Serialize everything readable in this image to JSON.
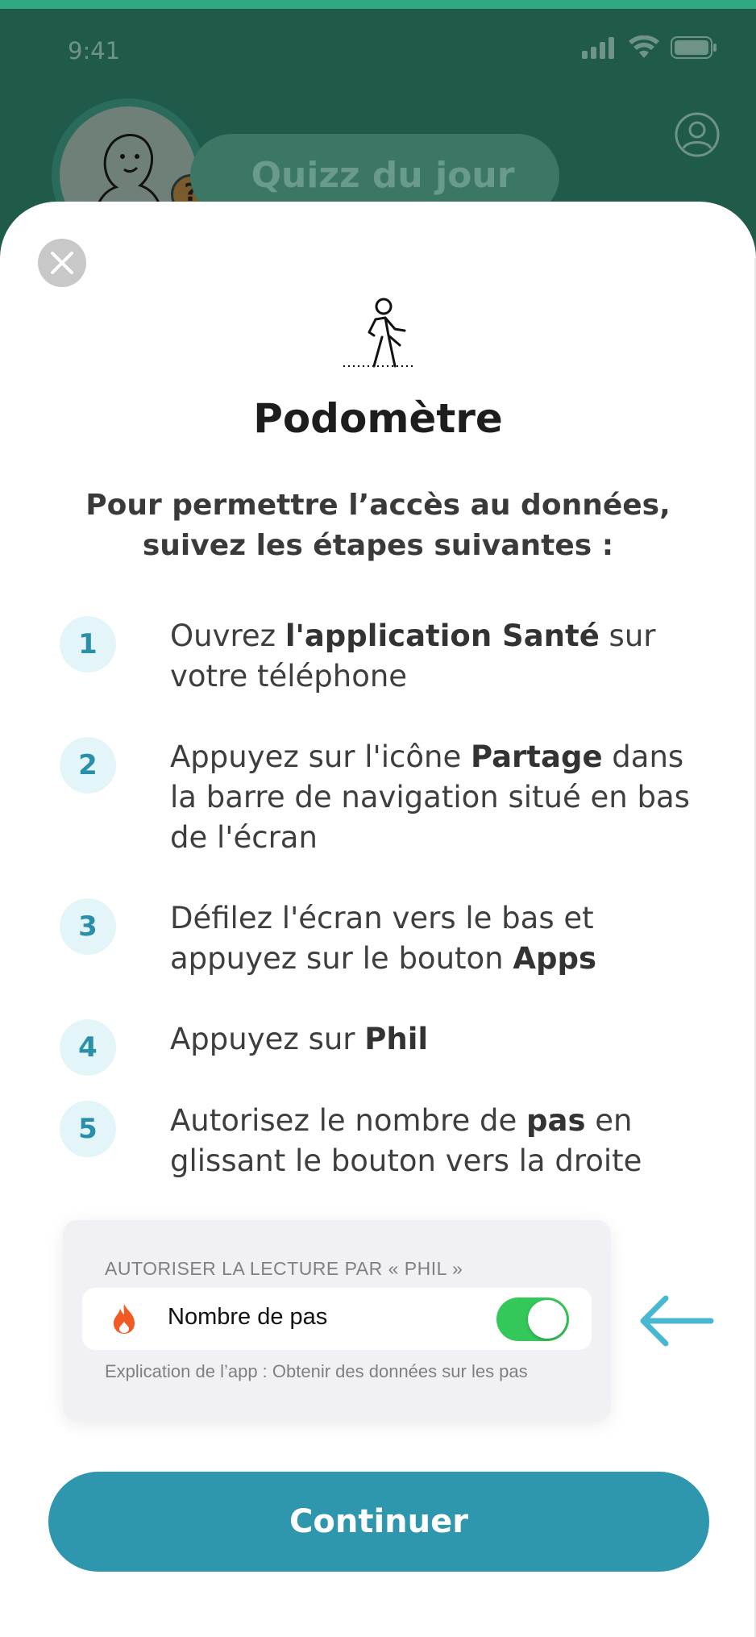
{
  "status_bar": {
    "time": "9:41"
  },
  "background": {
    "quiz_label": "Quizz du jour",
    "badge": "?"
  },
  "modal": {
    "title": "Podomètre",
    "subtitle": "Pour permettre l’accès au données, suivez les étapes suivantes :",
    "steps": [
      {
        "num": "1",
        "parts": [
          {
            "t": "Ouvrez "
          },
          {
            "t": "l'application Santé",
            "b": true
          },
          {
            "t": " sur votre téléphone"
          }
        ]
      },
      {
        "num": "2",
        "parts": [
          {
            "t": "Appuyez sur l'icône "
          },
          {
            "t": "Partage",
            "b": true
          },
          {
            "t": " dans la barre de navigation situé en bas de l'écran"
          }
        ]
      },
      {
        "num": "3",
        "parts": [
          {
            "t": "Défilez l'écran vers le bas et appuyez sur le bouton "
          },
          {
            "t": "Apps",
            "b": true
          }
        ]
      },
      {
        "num": "4",
        "parts": [
          {
            "t": "Appuyez sur "
          },
          {
            "t": "Phil",
            "b": true
          }
        ]
      },
      {
        "num": "5",
        "parts": [
          {
            "t": "Autorisez le nombre de "
          },
          {
            "t": "pas",
            "b": true
          },
          {
            "t": " en glissant le bouton vers la droite"
          }
        ]
      }
    ],
    "card": {
      "header": "AUTORISER LA LECTURE PAR « PHIL »",
      "row_label": "Nombre de pas",
      "toggle_on": true,
      "footer": "Explication de l’app : Obtenir des données sur les pas"
    },
    "continue_label": "Continuer"
  },
  "colors": {
    "accent": "#2e97ad",
    "toggle_green": "#34c759",
    "arrow": "#4ab7d2",
    "step_bg": "#e3f5f8"
  }
}
